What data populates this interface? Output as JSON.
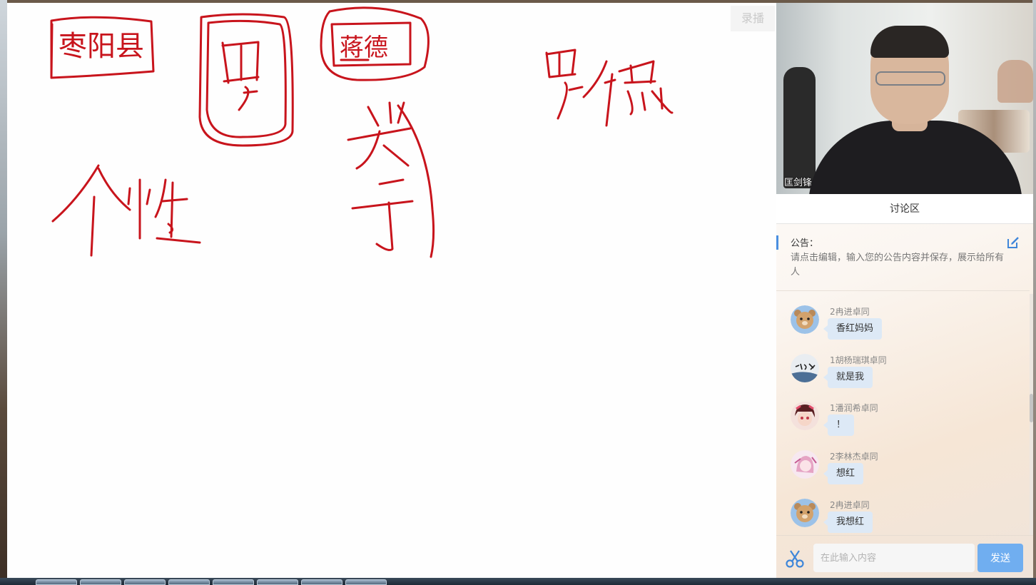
{
  "toolbar": {
    "record_label": "录播"
  },
  "video": {
    "presenter_name": "匡剑锋"
  },
  "discussion": {
    "title": "讨论区",
    "notice_title": "公告：",
    "notice_text": "请点击编辑，输入您的公告内容并保存，展示给所有人"
  },
  "messages": [
    {
      "name": "2冉进卓同",
      "text": "香红妈妈",
      "avatar": "bear-avatar"
    },
    {
      "name": "1胡杨瑞琪卓同",
      "text": "就是我",
      "avatar": "calligraphy-avatar"
    },
    {
      "name": "1潘润希卓同",
      "text": "！",
      "avatar": "anime-girl-avatar"
    },
    {
      "name": "2李林杰卓同",
      "text": "想红",
      "avatar": "pink-anime-avatar"
    },
    {
      "name": "2冉进卓同",
      "text": "我想红",
      "avatar": "bear-avatar"
    }
  ],
  "input": {
    "placeholder": "在此输入内容",
    "send_label": "发送"
  },
  "whiteboard": {
    "ink_color": "#c8141c",
    "handwritten_words": [
      "枣阳县",
      "罗",
      "蒋德",
      "兴哥",
      "个性",
      "罗德"
    ]
  },
  "colors": {
    "accent": "#70aef0",
    "notice_bar": "#4a8fe0",
    "bubble": "#dde9f6"
  }
}
